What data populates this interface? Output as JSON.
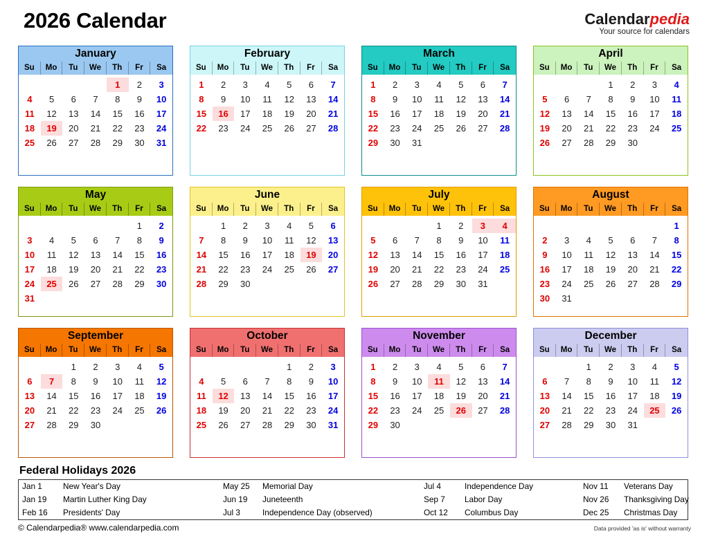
{
  "header": {
    "title": "2026 Calendar",
    "brand_part1": "Calendar",
    "brand_part2": "pedia",
    "tagline": "Your source for calendars"
  },
  "weekday_labels": [
    "Su",
    "Mo",
    "Tu",
    "We",
    "Th",
    "Fr",
    "Sa"
  ],
  "months": [
    {
      "name": "January",
      "header_bg": "#9ac8f0",
      "border": "#2a6fc0",
      "first_weekday": 4,
      "days": 31,
      "holidays": [
        1,
        19
      ]
    },
    {
      "name": "February",
      "header_bg": "#cdf6f8",
      "border": "#79cfe4",
      "first_weekday": 0,
      "days": 28,
      "holidays": [
        16
      ]
    },
    {
      "name": "March",
      "header_bg": "#23cbc2",
      "border": "#0a8c88",
      "first_weekday": 0,
      "days": 31,
      "holidays": []
    },
    {
      "name": "April",
      "header_bg": "#ccf2bd",
      "border": "#8cc31e",
      "first_weekday": 3,
      "days": 30,
      "holidays": []
    },
    {
      "name": "May",
      "header_bg": "#a8cc15",
      "border": "#7e9a0e",
      "first_weekday": 5,
      "days": 31,
      "holidays": [
        25
      ]
    },
    {
      "name": "June",
      "header_bg": "#fcf08c",
      "border": "#e0c421",
      "first_weekday": 1,
      "days": 30,
      "holidays": [
        19
      ]
    },
    {
      "name": "July",
      "header_bg": "#ffc20a",
      "border": "#e09b00",
      "first_weekday": 3,
      "days": 31,
      "holidays": [
        3,
        4
      ]
    },
    {
      "name": "August",
      "header_bg": "#ff9a22",
      "border": "#e07000",
      "first_weekday": 6,
      "days": 31,
      "holidays": []
    },
    {
      "name": "September",
      "header_bg": "#f57600",
      "border": "#b85600",
      "first_weekday": 2,
      "days": 30,
      "holidays": [
        7
      ]
    },
    {
      "name": "October",
      "header_bg": "#f07070",
      "border": "#c63030",
      "first_weekday": 4,
      "days": 31,
      "holidays": [
        12
      ]
    },
    {
      "name": "November",
      "header_bg": "#cd8ced",
      "border": "#9a4fd0",
      "first_weekday": 0,
      "days": 30,
      "holidays": [
        11,
        26
      ]
    },
    {
      "name": "December",
      "header_bg": "#ccccf0",
      "border": "#8f8fd8",
      "first_weekday": 2,
      "days": 31,
      "holidays": [
        25
      ]
    }
  ],
  "holidays_section": {
    "title": "Federal Holidays 2026",
    "rows": [
      [
        {
          "date": "Jan 1",
          "name": "New Year's Day"
        },
        {
          "date": "May 25",
          "name": "Memorial Day"
        },
        {
          "date": "Jul 4",
          "name": "Independence Day"
        },
        {
          "date": "Nov 11",
          "name": "Veterans Day"
        }
      ],
      [
        {
          "date": "Jan 19",
          "name": "Martin Luther King Day"
        },
        {
          "date": "Jun 19",
          "name": "Juneteenth"
        },
        {
          "date": "Sep 7",
          "name": "Labor Day"
        },
        {
          "date": "Nov 26",
          "name": "Thanksgiving Day"
        }
      ],
      [
        {
          "date": "Feb 16",
          "name": "Presidents' Day"
        },
        {
          "date": "Jul 3",
          "name": "Independence Day (observed)"
        },
        {
          "date": "Oct 12",
          "name": "Columbus Day"
        },
        {
          "date": "Dec 25",
          "name": "Christmas Day"
        }
      ]
    ]
  },
  "footer": {
    "copyright": "© Calendarpedia®   www.calendarpedia.com",
    "disclaimer": "Data provided 'as is' without warranty"
  },
  "colors": {
    "sunday": "#e00000",
    "saturday": "#0000e0",
    "holiday_bg": "#fcdcdc",
    "brand_accent": "#e01b1b"
  }
}
